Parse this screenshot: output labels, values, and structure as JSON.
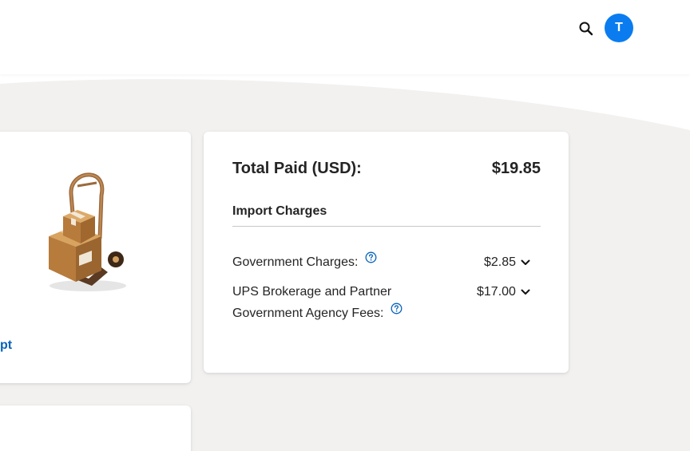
{
  "header": {
    "search_icon": "search-icon",
    "avatar_initial": "T",
    "avatar_color": "#0a7cf0"
  },
  "receipt_card": {
    "link_text": "pt",
    "illustration": "hand-truck-boxes-icon"
  },
  "charges_card": {
    "total_label": "Total Paid (USD):",
    "total_value": "$19.85",
    "section_title": "Import Charges",
    "rows": [
      {
        "label": "Government Charges:",
        "value": "$2.85",
        "help_icon": "question-circle-icon",
        "expand_icon": "chevron-down-icon"
      },
      {
        "label_line1": "UPS Brokerage and Partner",
        "label_line2": "Government Agency Fees:",
        "value": "$17.00",
        "help_icon": "question-circle-icon",
        "expand_icon": "chevron-down-icon"
      }
    ]
  },
  "colors": {
    "link": "#0662bb",
    "accent": "#0a7cf0",
    "background": "#f2f1f0"
  }
}
